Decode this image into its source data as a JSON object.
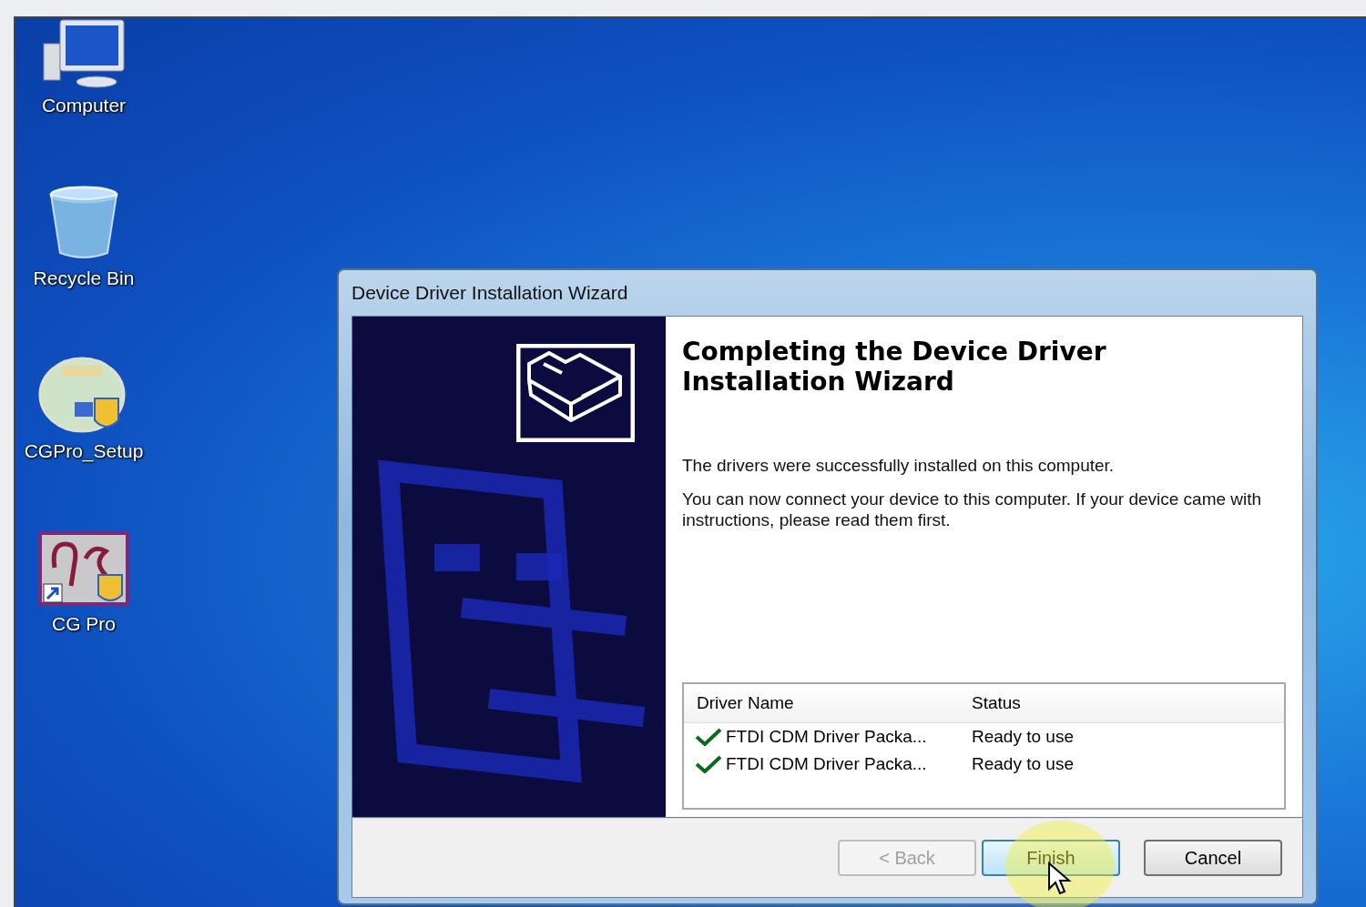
{
  "desktop_icons": [
    {
      "label": "Computer",
      "kind": "computer"
    },
    {
      "label": "Recycle Bin",
      "kind": "recycle"
    },
    {
      "label": "CGPro_Setup",
      "kind": "setup"
    },
    {
      "label": "CG Pro",
      "kind": "app"
    }
  ],
  "window": {
    "title": "Device Driver Installation Wizard"
  },
  "heading": "Completing the Device Driver Installation Wizard",
  "paragraphs": [
    "The drivers were successfully installed on this computer.",
    "You can now connect your device to this computer. If your device came with instructions, please read them first."
  ],
  "table": {
    "columns": [
      "Driver Name",
      "Status"
    ],
    "rows": [
      {
        "name": "FTDI CDM Driver Packa...",
        "status": "Ready to use"
      },
      {
        "name": "FTDI CDM Driver Packa...",
        "status": "Ready to use"
      }
    ]
  },
  "buttons": [
    {
      "label": "< Back",
      "disabled": true,
      "hovered": false
    },
    {
      "label": "Finish",
      "disabled": false,
      "hovered": true
    },
    {
      "label": "Cancel",
      "disabled": false,
      "hovered": false
    }
  ]
}
